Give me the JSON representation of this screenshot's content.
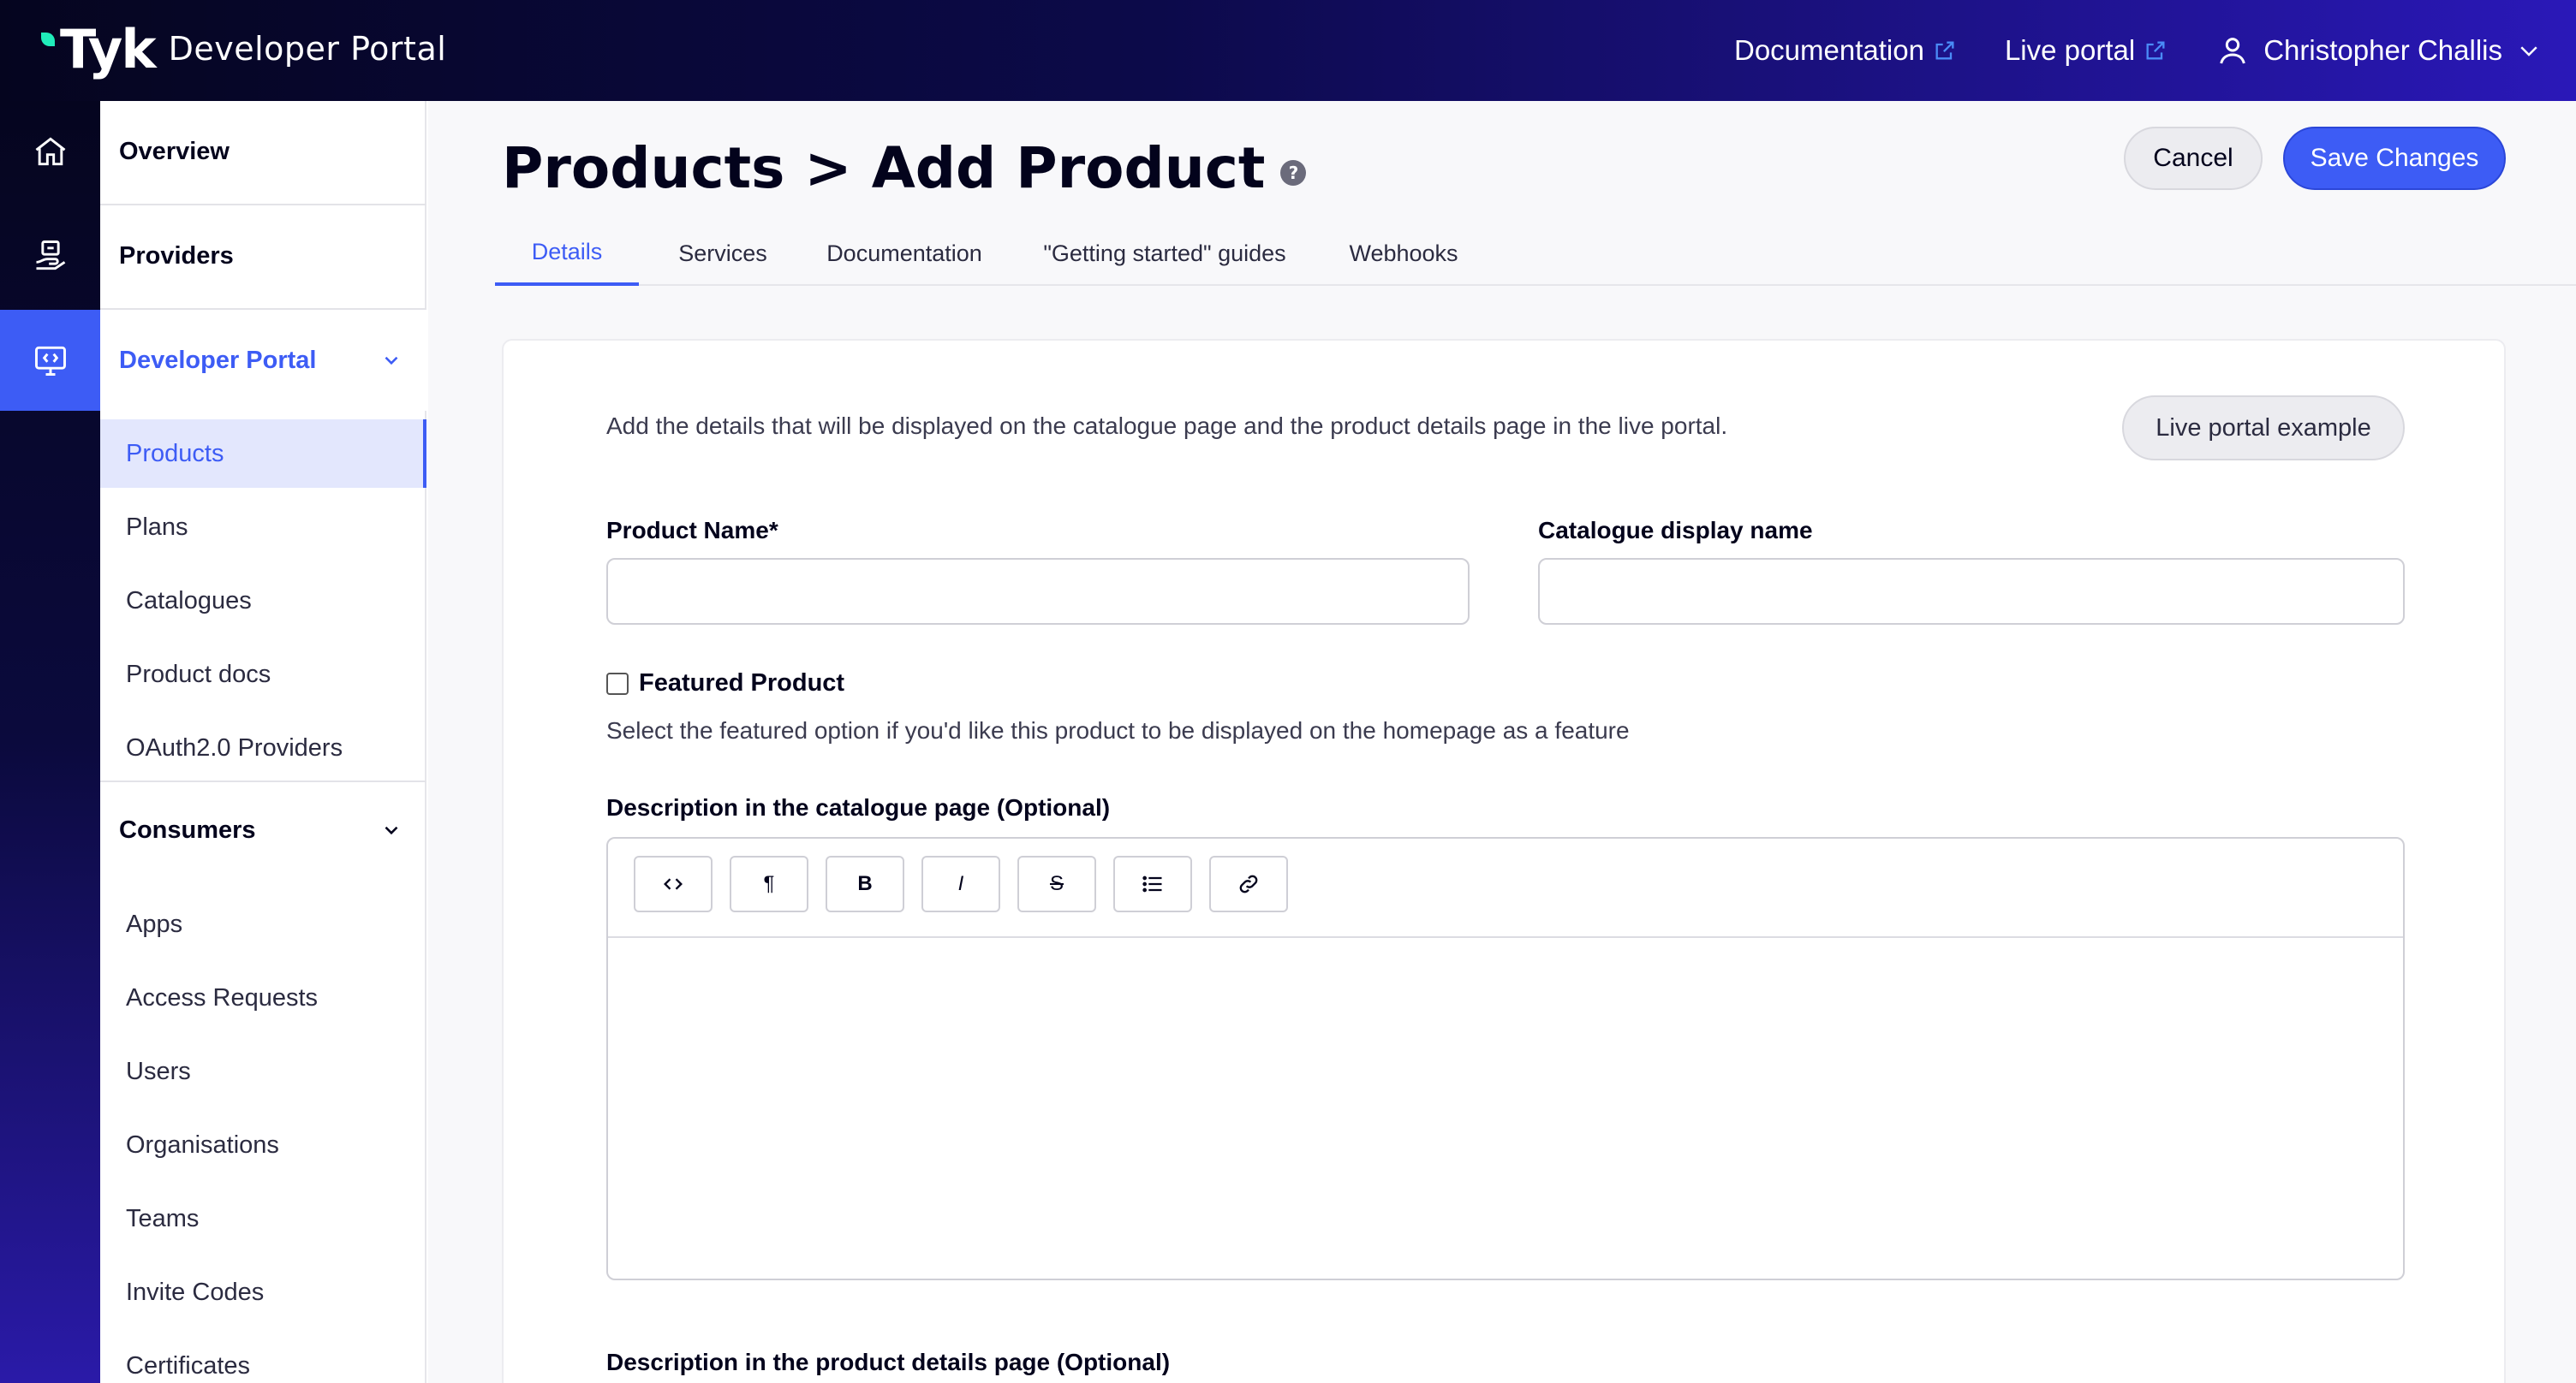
{
  "header": {
    "brand_mark": "Tyk",
    "brand_text": "Developer Portal",
    "links": [
      {
        "label": "Documentation",
        "icon": "external-link-icon"
      },
      {
        "label": "Live portal",
        "icon": "external-link-icon"
      }
    ],
    "user_name": "Christopher Challis"
  },
  "rail": {
    "items": [
      {
        "icon": "home-icon"
      },
      {
        "icon": "providers-icon"
      },
      {
        "icon": "developer-portal-icon",
        "active": true
      }
    ]
  },
  "sidebar": {
    "overview": "Overview",
    "providers": "Providers",
    "developer_portal": "Developer Portal",
    "portal_items": [
      "Products",
      "Plans",
      "Catalogues",
      "Product docs",
      "OAuth2.0 Providers"
    ],
    "consumers": "Consumers",
    "consumer_items": [
      "Apps",
      "Access Requests",
      "Users",
      "Organisations",
      "Teams",
      "Invite Codes",
      "Certificates"
    ]
  },
  "page": {
    "title": "Products > Add Product",
    "help_glyph": "?",
    "cancel_label": "Cancel",
    "save_label": "Save Changes",
    "tabs": [
      "Details",
      "Services",
      "Documentation",
      "\"Getting started\" guides",
      "Webhooks"
    ],
    "active_tab": "Details"
  },
  "form": {
    "intro": "Add the details that will be displayed on the catalogue page and the product details page in the live portal.",
    "example_button": "Live portal example",
    "product_name_label": "Product Name*",
    "product_name_value": "",
    "catalogue_display_label": "Catalogue display name",
    "catalogue_display_value": "",
    "featured_label": "Featured Product",
    "featured_checked": false,
    "featured_help": "Select the featured option if you'd like this product to be displayed on the homepage as a feature",
    "catalogue_desc_label": "Description in the catalogue page (Optional)",
    "editor_tools": [
      {
        "label": "<>",
        "icon": "code-icon"
      },
      {
        "label": "¶",
        "icon": "paragraph-icon"
      },
      {
        "label": "B",
        "icon": "bold-icon"
      },
      {
        "label": "I",
        "icon": "italic-icon"
      },
      {
        "label": "S",
        "icon": "strikethrough-icon"
      },
      {
        "label": "",
        "icon": "bullet-list-icon"
      },
      {
        "label": "",
        "icon": "link-icon"
      }
    ],
    "product_details_desc_label": "Description in the product details page (Optional)"
  },
  "colors": {
    "accent": "#3d5cf5",
    "brand_leaf": "#20edba",
    "topbar_dark": "#05051f",
    "topbar_end": "#2a18b8"
  }
}
